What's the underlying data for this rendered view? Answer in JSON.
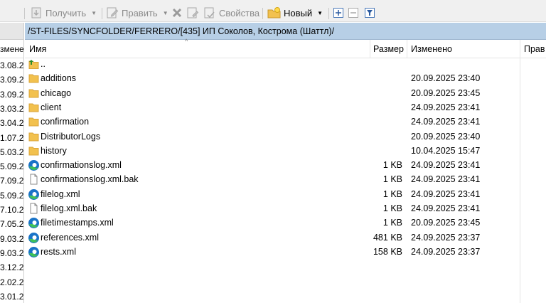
{
  "toolbar": {
    "get_label": "Получить",
    "edit_label": "Править",
    "properties_label": "Свойства",
    "new_label": "Новый"
  },
  "left_pane": {
    "header_label": "зменен",
    "dates": [
      "3.08.2",
      "3.09.2",
      "3.09.2",
      "3.03.2",
      "3.04.2",
      "1.07.2",
      "5.03.2",
      "5.09.2",
      "7.09.2",
      "5.09.2",
      "7.10.2",
      "7.05.2",
      "9.03.2",
      "9.03.2",
      "3.12.2",
      "2.02.2",
      "3.01.2"
    ]
  },
  "path": "/ST-FILES/SYNCFOLDER/FERRERO/[435] ИП Соколов, Кострома (Шаттл)/",
  "columns": {
    "name": "Имя",
    "size": "Размер",
    "modified": "Изменено",
    "rights": "Прав"
  },
  "files": [
    {
      "name": "..",
      "size": "",
      "date": "",
      "icon": "parent-folder-icon"
    },
    {
      "name": "additions",
      "size": "",
      "date": "20.09.2025 23:40",
      "icon": "folder-icon"
    },
    {
      "name": "chicago",
      "size": "",
      "date": "20.09.2025 23:45",
      "icon": "folder-icon"
    },
    {
      "name": "client",
      "size": "",
      "date": "24.09.2025 23:41",
      "icon": "folder-icon"
    },
    {
      "name": "confirmation",
      "size": "",
      "date": "24.09.2025 23:41",
      "icon": "folder-icon"
    },
    {
      "name": "DistributorLogs",
      "size": "",
      "date": "20.09.2025 23:40",
      "icon": "folder-icon"
    },
    {
      "name": "history",
      "size": "",
      "date": "10.04.2025 15:47",
      "icon": "folder-icon"
    },
    {
      "name": "confirmationslog.xml",
      "size": "1 KB",
      "date": "24.09.2025 23:41",
      "icon": "edge-xml-icon"
    },
    {
      "name": "confirmationslog.xml.bak",
      "size": "1 KB",
      "date": "24.09.2025 23:41",
      "icon": "file-icon"
    },
    {
      "name": "filelog.xml",
      "size": "1 KB",
      "date": "24.09.2025 23:41",
      "icon": "edge-xml-icon"
    },
    {
      "name": "filelog.xml.bak",
      "size": "1 KB",
      "date": "24.09.2025 23:41",
      "icon": "file-icon"
    },
    {
      "name": "filetimestamps.xml",
      "size": "1 KB",
      "date": "20.09.2025 23:45",
      "icon": "edge-xml-icon"
    },
    {
      "name": "references.xml",
      "size": "481 KB",
      "date": "24.09.2025 23:37",
      "icon": "edge-xml-icon"
    },
    {
      "name": "rests.xml",
      "size": "158 KB",
      "date": "24.09.2025 23:37",
      "icon": "edge-xml-icon"
    }
  ],
  "colors": {
    "pathbar_bg": "#b7cfe6",
    "folder": "#f2c14e",
    "edge_blue": "#1a73c8",
    "edge_green": "#3ec05a"
  }
}
